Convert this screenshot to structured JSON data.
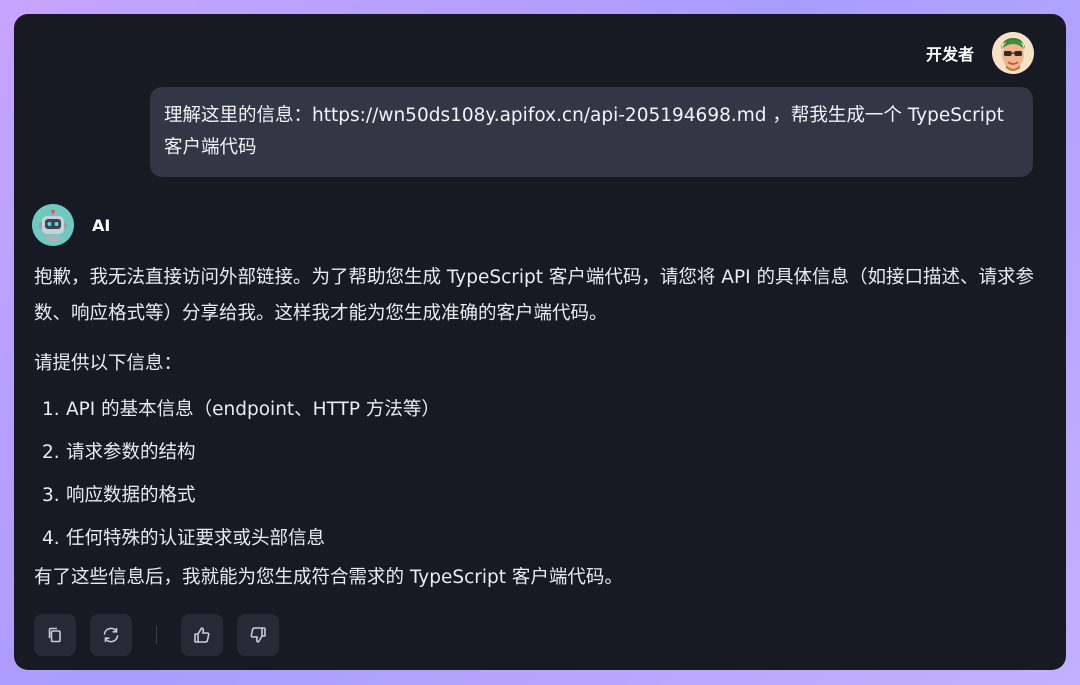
{
  "user": {
    "name": "开发者",
    "avatar_icon": "memoji-avatar-icon"
  },
  "user_message": {
    "text": "理解这里的信息：https://wn50ds108y.apifox.cn/api-205194698.md ，帮我生成一个 TypeScript 客户端代码"
  },
  "ai": {
    "name": "AI",
    "avatar_icon": "robot-avatar-icon",
    "paragraph1": "抱歉，我无法直接访问外部链接。为了帮助您生成 TypeScript 客户端代码，请您将 API 的具体信息（如接口描述、请求参数、响应格式等）分享给我。这样我才能为您生成准确的客户端代码。",
    "paragraph2": "请提供以下信息：",
    "list": [
      {
        "num": "1.",
        "text": "API 的基本信息（endpoint、HTTP 方法等）"
      },
      {
        "num": "2.",
        "text": "请求参数的结构"
      },
      {
        "num": "3.",
        "text": "响应数据的格式"
      },
      {
        "num": "4.",
        "text": "任何特殊的认证要求或头部信息"
      }
    ],
    "paragraph3": "有了这些信息后，我就能为您生成符合需求的 TypeScript 客户端代码。"
  },
  "actions": {
    "copy_icon": "copy-icon",
    "regenerate_icon": "refresh-icon",
    "like_icon": "thumbs-up-icon",
    "dislike_icon": "thumbs-down-icon"
  },
  "colors": {
    "window_bg": "#171a23",
    "bubble_bg": "#323645",
    "text": "#e9ebf1",
    "button_bg": "#262a35"
  }
}
